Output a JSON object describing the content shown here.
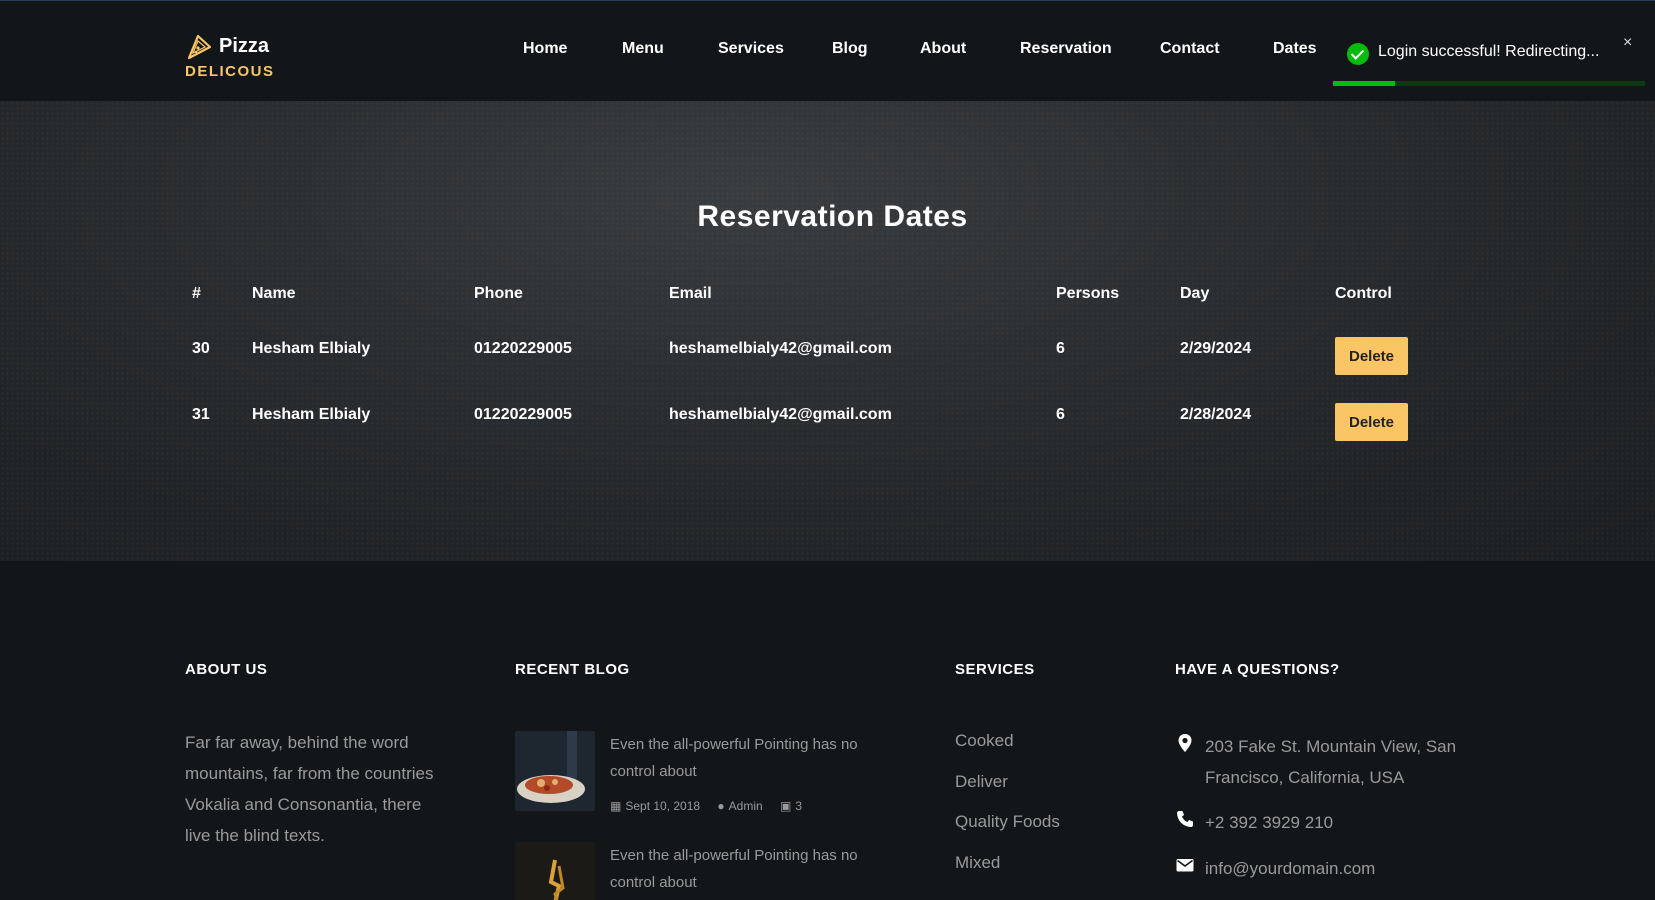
{
  "brand": {
    "name": "Pizza",
    "tagline": "DELICOUS"
  },
  "nav": {
    "items": [
      "Home",
      "Menu",
      "Services",
      "Blog",
      "About",
      "Reservation",
      "Contact",
      "Dates"
    ]
  },
  "toast": {
    "message": "Login successful! Redirecting...",
    "close": "×",
    "progress": 0.2
  },
  "page": {
    "title": "Reservation Dates"
  },
  "table": {
    "headers": [
      "#",
      "Name",
      "Phone",
      "Email",
      "Persons",
      "Day",
      "Control"
    ],
    "rows": [
      {
        "id": "30",
        "name": "Hesham Elbialy",
        "phone": "01220229005",
        "email": "heshamelbialy42@gmail.com",
        "persons": "6",
        "day": "2/29/2024",
        "action": "Delete"
      },
      {
        "id": "31",
        "name": "Hesham Elbialy",
        "phone": "01220229005",
        "email": "heshamelbialy42@gmail.com",
        "persons": "6",
        "day": "2/28/2024",
        "action": "Delete"
      }
    ]
  },
  "footer": {
    "about": {
      "heading": "ABOUT US",
      "text": "Far far away, behind the word mountains, far from the countries Vokalia and Consonantia, there live the blind texts."
    },
    "blog": {
      "heading": "RECENT BLOG",
      "posts": [
        {
          "title": "Even the all-powerful Pointing has no control about",
          "date": "Sept 10, 2018",
          "author": "Admin",
          "comments": "3"
        },
        {
          "title": "Even the all-powerful Pointing has no control about"
        }
      ]
    },
    "services": {
      "heading": "SERVICES",
      "items": [
        "Cooked",
        "Deliver",
        "Quality Foods",
        "Mixed"
      ]
    },
    "contact": {
      "heading": "HAVE A QUESTIONS?",
      "address": "203 Fake St. Mountain View, San Francisco, California, USA",
      "phone": "+2 392 3929 210",
      "email": "info@yourdomain.com"
    }
  },
  "colors": {
    "accent": "#fac564",
    "success": "#07bc0c",
    "background": "#121618"
  }
}
